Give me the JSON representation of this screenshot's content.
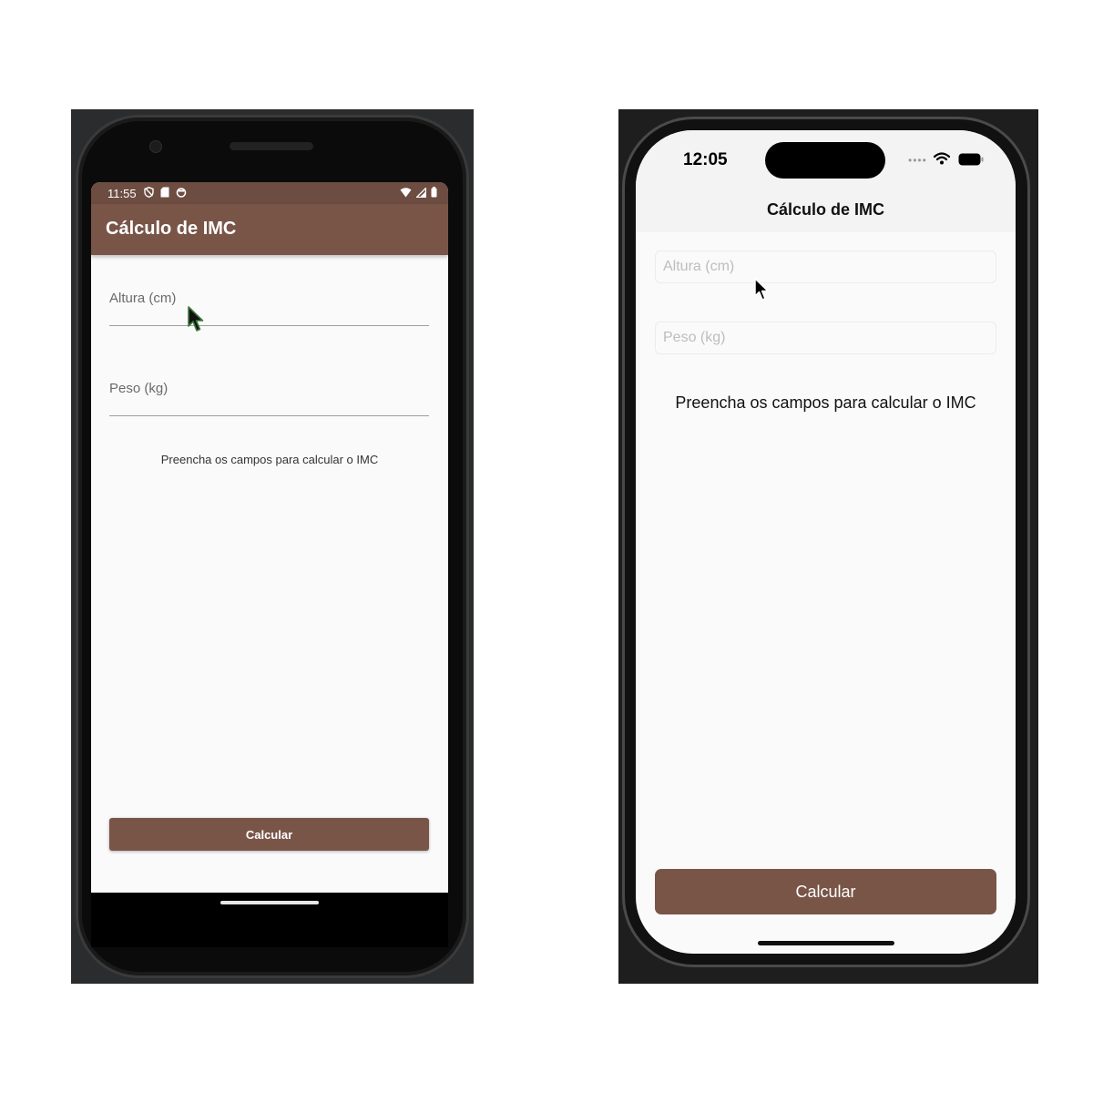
{
  "android": {
    "status_time": "11:55",
    "app_title": "Cálculo de IMC",
    "height_label": "Altura (cm)",
    "weight_label": "Peso (kg)",
    "message": "Preencha os campos para calcular o IMC",
    "button_label": "Calcular",
    "colors": {
      "app_bar": "#795548",
      "status_bar": "#6d4c41",
      "button": "#795548"
    }
  },
  "ios": {
    "status_time": "12:05",
    "nav_title": "Cálculo de IMC",
    "height_placeholder": "Altura (cm)",
    "weight_placeholder": "Peso (kg)",
    "message": "Preencha os campos para calcular o IMC",
    "button_label": "Calcular",
    "colors": {
      "button": "#795548"
    }
  },
  "icons": [
    "shield-icon",
    "sd-card-icon",
    "sync-icon",
    "wifi-icon",
    "cell-signal-icon",
    "battery-icon",
    "mouse-cursor-icon"
  ]
}
